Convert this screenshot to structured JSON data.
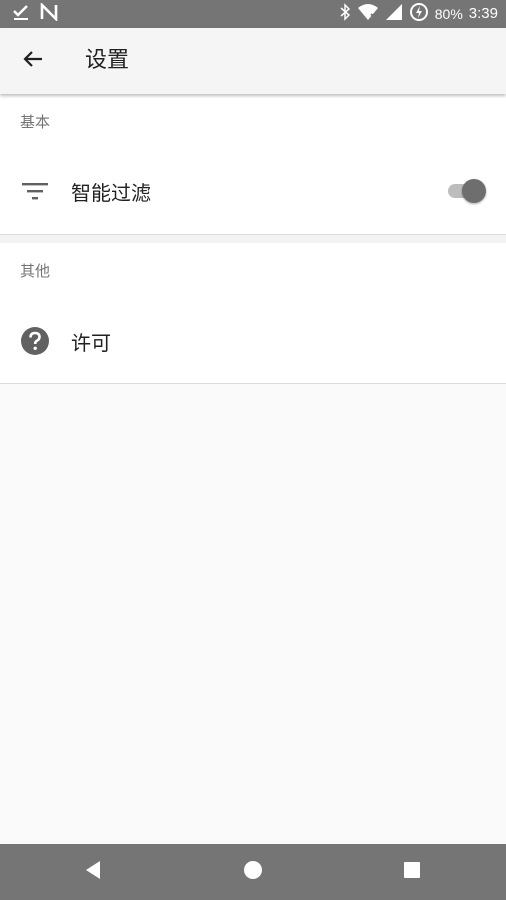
{
  "status_bar": {
    "battery_percent": "80%",
    "time": "3:39",
    "icons": [
      "checkmark-download-icon",
      "n-notification-icon",
      "bluetooth-icon",
      "wifi-icon",
      "cell-signal-icon",
      "battery-charging-icon"
    ]
  },
  "app_bar": {
    "title": "设置",
    "back_icon": "arrow-back-icon"
  },
  "sections": [
    {
      "header": "基本",
      "items": [
        {
          "label": "智能过滤",
          "icon": "filter-icon",
          "toggle": true,
          "toggle_state": "on"
        }
      ]
    },
    {
      "header": "其他",
      "items": [
        {
          "label": "许可",
          "icon": "help-circle-icon"
        }
      ]
    }
  ],
  "nav_bar": {
    "buttons": [
      "back-triangle-icon",
      "home-circle-icon",
      "recents-square-icon"
    ]
  },
  "colors": {
    "status_bar": "#757575",
    "app_bar": "#f5f5f5",
    "background": "#fafafa",
    "text_primary": "#212121",
    "text_secondary": "#757575"
  }
}
